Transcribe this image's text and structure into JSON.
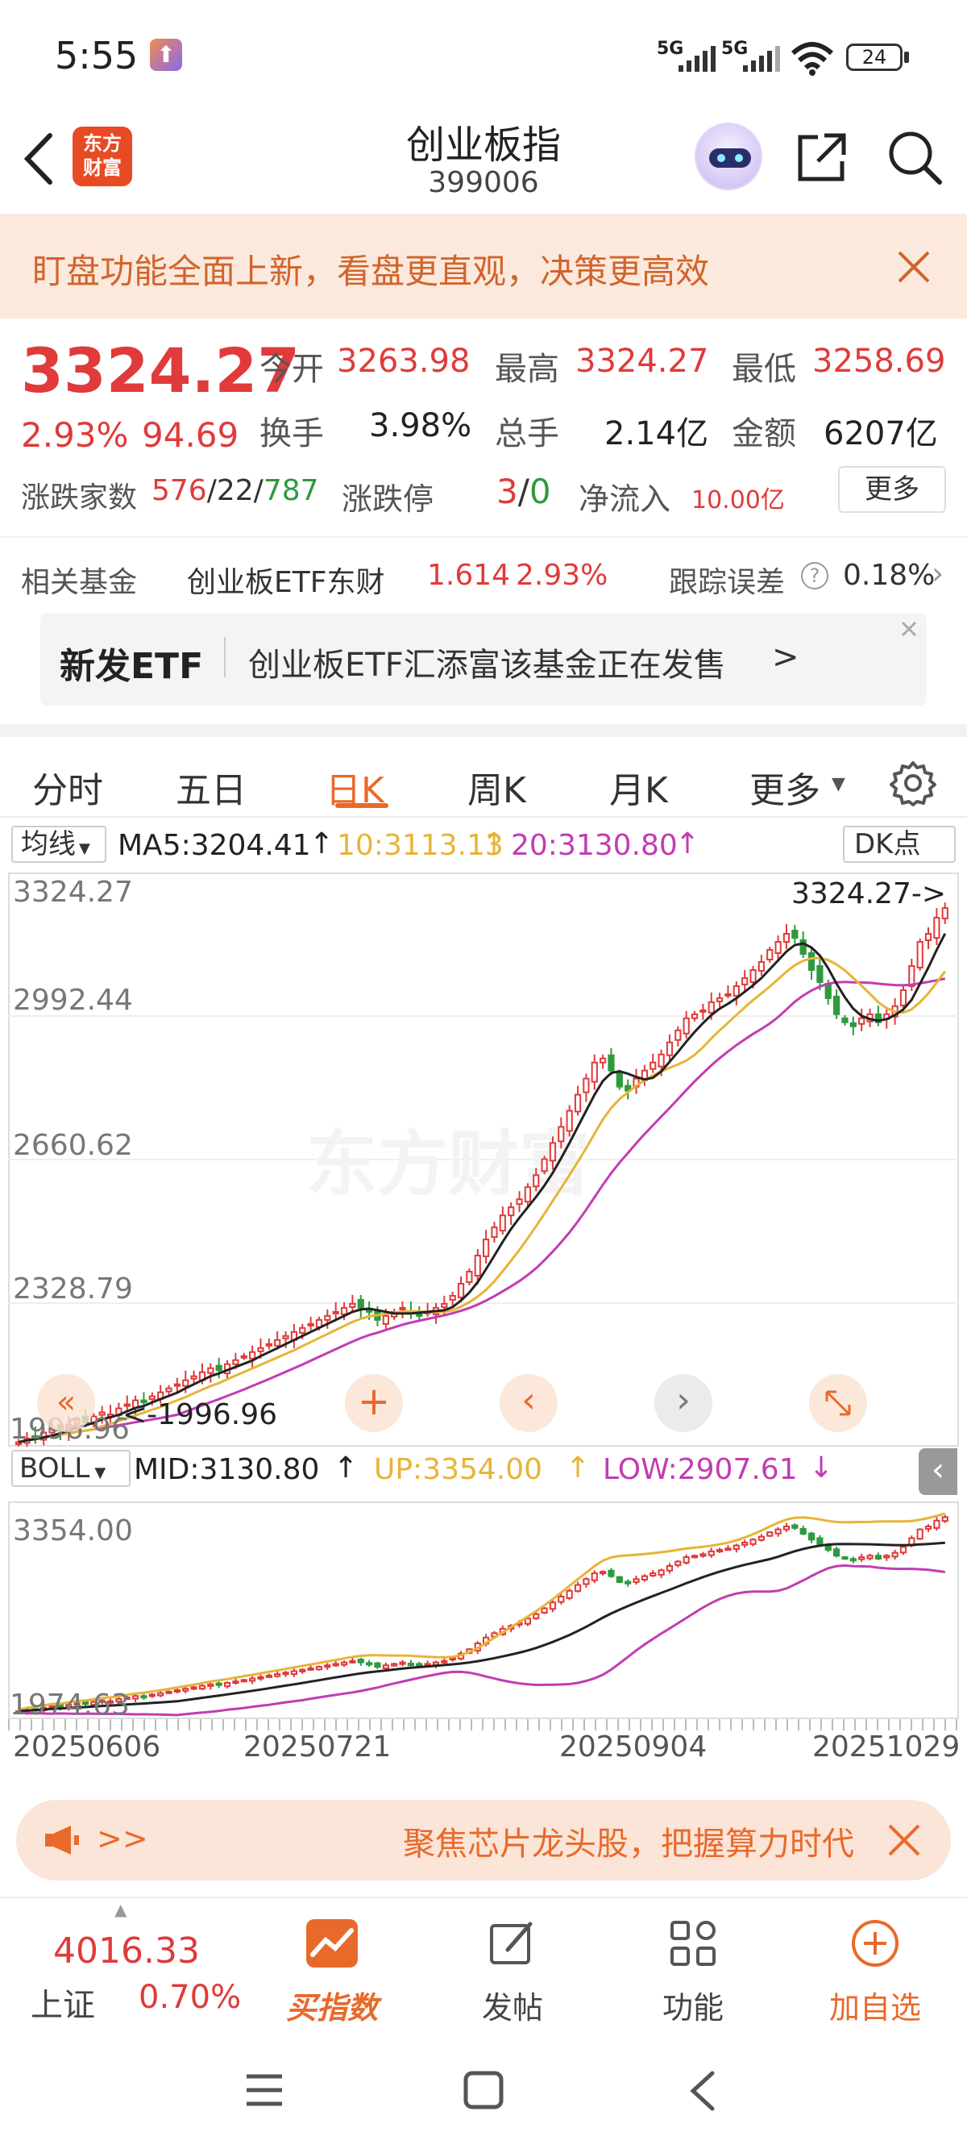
{
  "status": {
    "time": "5:55",
    "battery": "24",
    "net1": "5G",
    "net2": "5G"
  },
  "header": {
    "title": "创业板指",
    "code": "399006",
    "logo_text_1": "东方",
    "logo_text_2": "财富"
  },
  "banner": {
    "text": "盯盘功能全面上新，看盘更直观，决策更高效"
  },
  "quote": {
    "price": "3324.27",
    "change_pct": "2.93%",
    "change": "94.69",
    "open_label": "今开",
    "open": "3263.98",
    "high_label": "最高",
    "high": "3324.27",
    "low_label": "最低",
    "low": "3258.69",
    "turnover_label": "换手",
    "turnover": "3.98%",
    "volume_label": "总手",
    "volume": "2.14亿",
    "amount_label": "金额",
    "amount": "6207亿",
    "breadth_label": "涨跌家数",
    "up": "576",
    "flat": "22",
    "down": "787",
    "limit_label": "涨跌停",
    "limit_up": "3",
    "limit_down": "0",
    "inflow_label": "净流入",
    "inflow": "10.00亿",
    "more": "更多"
  },
  "fund": {
    "label": "相关基金",
    "name": "创业板ETF东财",
    "price": "1.614",
    "pct": "2.93%",
    "track_label": "跟踪误差",
    "track": "0.18%"
  },
  "etf": {
    "tag": "新发ETF",
    "text": "创业板ETF汇添富该基金正在发售",
    "arrow": ">"
  },
  "tabs": [
    {
      "label": "分时"
    },
    {
      "label": "五日"
    },
    {
      "label": "日K"
    },
    {
      "label": "周K"
    },
    {
      "label": "月K"
    },
    {
      "label": "更多"
    }
  ],
  "chart_head": {
    "ma_select": "均线",
    "ma5": "MA5:3204.41",
    "ma10": "10:3113.13",
    "ma20": "20:3130.80",
    "dk": "DK点"
  },
  "main_axis": {
    "t1": "3324.27",
    "t2": "2992.44",
    "t3": "2660.62",
    "t4": "2328.79",
    "t5": "1996.96",
    "hi_label": "3324.27->",
    "lo_label": "<-1996.96",
    "watermark": "东方财富"
  },
  "boll_head": {
    "select": "BOLL",
    "mid": "MID:3130.80",
    "up": "UP:3354.00",
    "low": "LOW:2907.61"
  },
  "boll_axis": {
    "t1": "3354.00",
    "t2": "1974.63"
  },
  "dates": {
    "d1": "20250606",
    "d2": "20250721",
    "d3": "20250904",
    "d4": "20251029"
  },
  "ad": {
    "prefix": ">>",
    "text": "聚焦芯片龙头股，把握算力时代"
  },
  "bottom": {
    "index_value": "4016.33",
    "index_name": "上证",
    "index_pct": "0.70%",
    "buy": "买指数",
    "post": "发帖",
    "func": "功能",
    "add": "加自选"
  },
  "chart_data": {
    "type": "candlestick",
    "main_range": [
      1996.96,
      3324.27
    ],
    "boll_range": [
      1974.63,
      3354.0
    ],
    "closes": [
      1996,
      2005,
      2010,
      2020,
      2030,
      2025,
      2040,
      2050,
      2045,
      2060,
      2070,
      2065,
      2080,
      2090,
      2100,
      2095,
      2110,
      2120,
      2130,
      2140,
      2150,
      2160,
      2170,
      2180,
      2175,
      2190,
      2200,
      2210,
      2220,
      2230,
      2240,
      2250,
      2260,
      2270,
      2280,
      2290,
      2300,
      2310,
      2320,
      2330,
      2340,
      2330,
      2320,
      2300,
      2310,
      2320,
      2330,
      2320,
      2310,
      2320,
      2330,
      2340,
      2360,
      2390,
      2420,
      2460,
      2500,
      2530,
      2560,
      2580,
      2600,
      2630,
      2660,
      2700,
      2740,
      2780,
      2820,
      2860,
      2900,
      2940,
      2950,
      2920,
      2880,
      2870,
      2900,
      2920,
      2940,
      2960,
      2990,
      3020,
      3050,
      3060,
      3070,
      3090,
      3100,
      3110,
      3130,
      3150,
      3170,
      3190,
      3220,
      3240,
      3260,
      3250,
      3210,
      3170,
      3140,
      3100,
      3060,
      3040,
      3030,
      3050,
      3060,
      3040,
      3060,
      3080,
      3120,
      3180,
      3240,
      3260,
      3300,
      3324
    ]
  }
}
